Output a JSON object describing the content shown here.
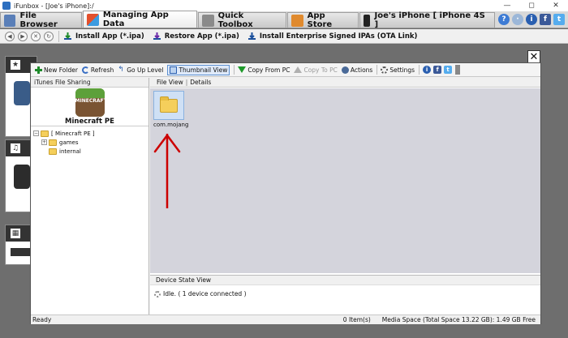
{
  "window": {
    "title": "iFunbox - [Joe's iPhone]:/"
  },
  "window_controls": {
    "minimize": "—",
    "maximize": "◻",
    "close": "✕"
  },
  "tabs": [
    {
      "label": "File Browser",
      "icon": "house-icon",
      "active": false
    },
    {
      "label": "Managing App Data",
      "icon": "app-grid-icon",
      "active": true
    },
    {
      "label": "Quick Toolbox",
      "icon": "toolbox-icon",
      "active": false
    },
    {
      "label": "App Store",
      "icon": "app-store-icon",
      "active": false
    },
    {
      "label": "Joe's iPhone [ iPhone 4S ]",
      "icon": "iphone-icon",
      "active": false
    }
  ],
  "toolbar": {
    "install_app": "Install App (*.ipa)",
    "restore_app": "Restore App (*.ipa)",
    "install_enterprise": "Install Enterprise Signed IPAs (OTA Link)"
  },
  "background": {
    "panel1_icon": "★",
    "panel2_icon": "♫",
    "panel3_icon": "▦"
  },
  "dialog": {
    "close_label": "✕",
    "toolbar": {
      "new_folder": "New Folder",
      "refresh": "Refresh",
      "go_up": "Go Up Level",
      "thumbnail_view": "Thumbnail View",
      "copy_from_pc": "Copy From PC",
      "copy_to_pc": "Copy To PC",
      "actions": "Actions",
      "settings": "Settings"
    },
    "left": {
      "header": "iTunes File Sharing",
      "app_name": "Minecraft PE",
      "app_icon_text": "MINECRAFT",
      "tree": {
        "root": "[ Minecraft PE ]",
        "expander_minus": "−",
        "expander_plus": "+",
        "children": [
          "games",
          "internal"
        ]
      }
    },
    "right": {
      "view_tabs": {
        "file_view": "File View",
        "separator": "|",
        "details": "Details"
      },
      "files": [
        {
          "name": "com.mojang"
        }
      ],
      "device_state": {
        "header": "Device State View",
        "status": "Idle.  ( 1 device connected )"
      }
    },
    "status": {
      "left": "Ready",
      "items": "0 Item(s)",
      "space": "Media Space (Total Space 13.22 GB): 1.49 GB Free"
    }
  },
  "colors": {
    "annotation_arrow": "#cc0000",
    "active_view_border": "#5b8fd0"
  }
}
